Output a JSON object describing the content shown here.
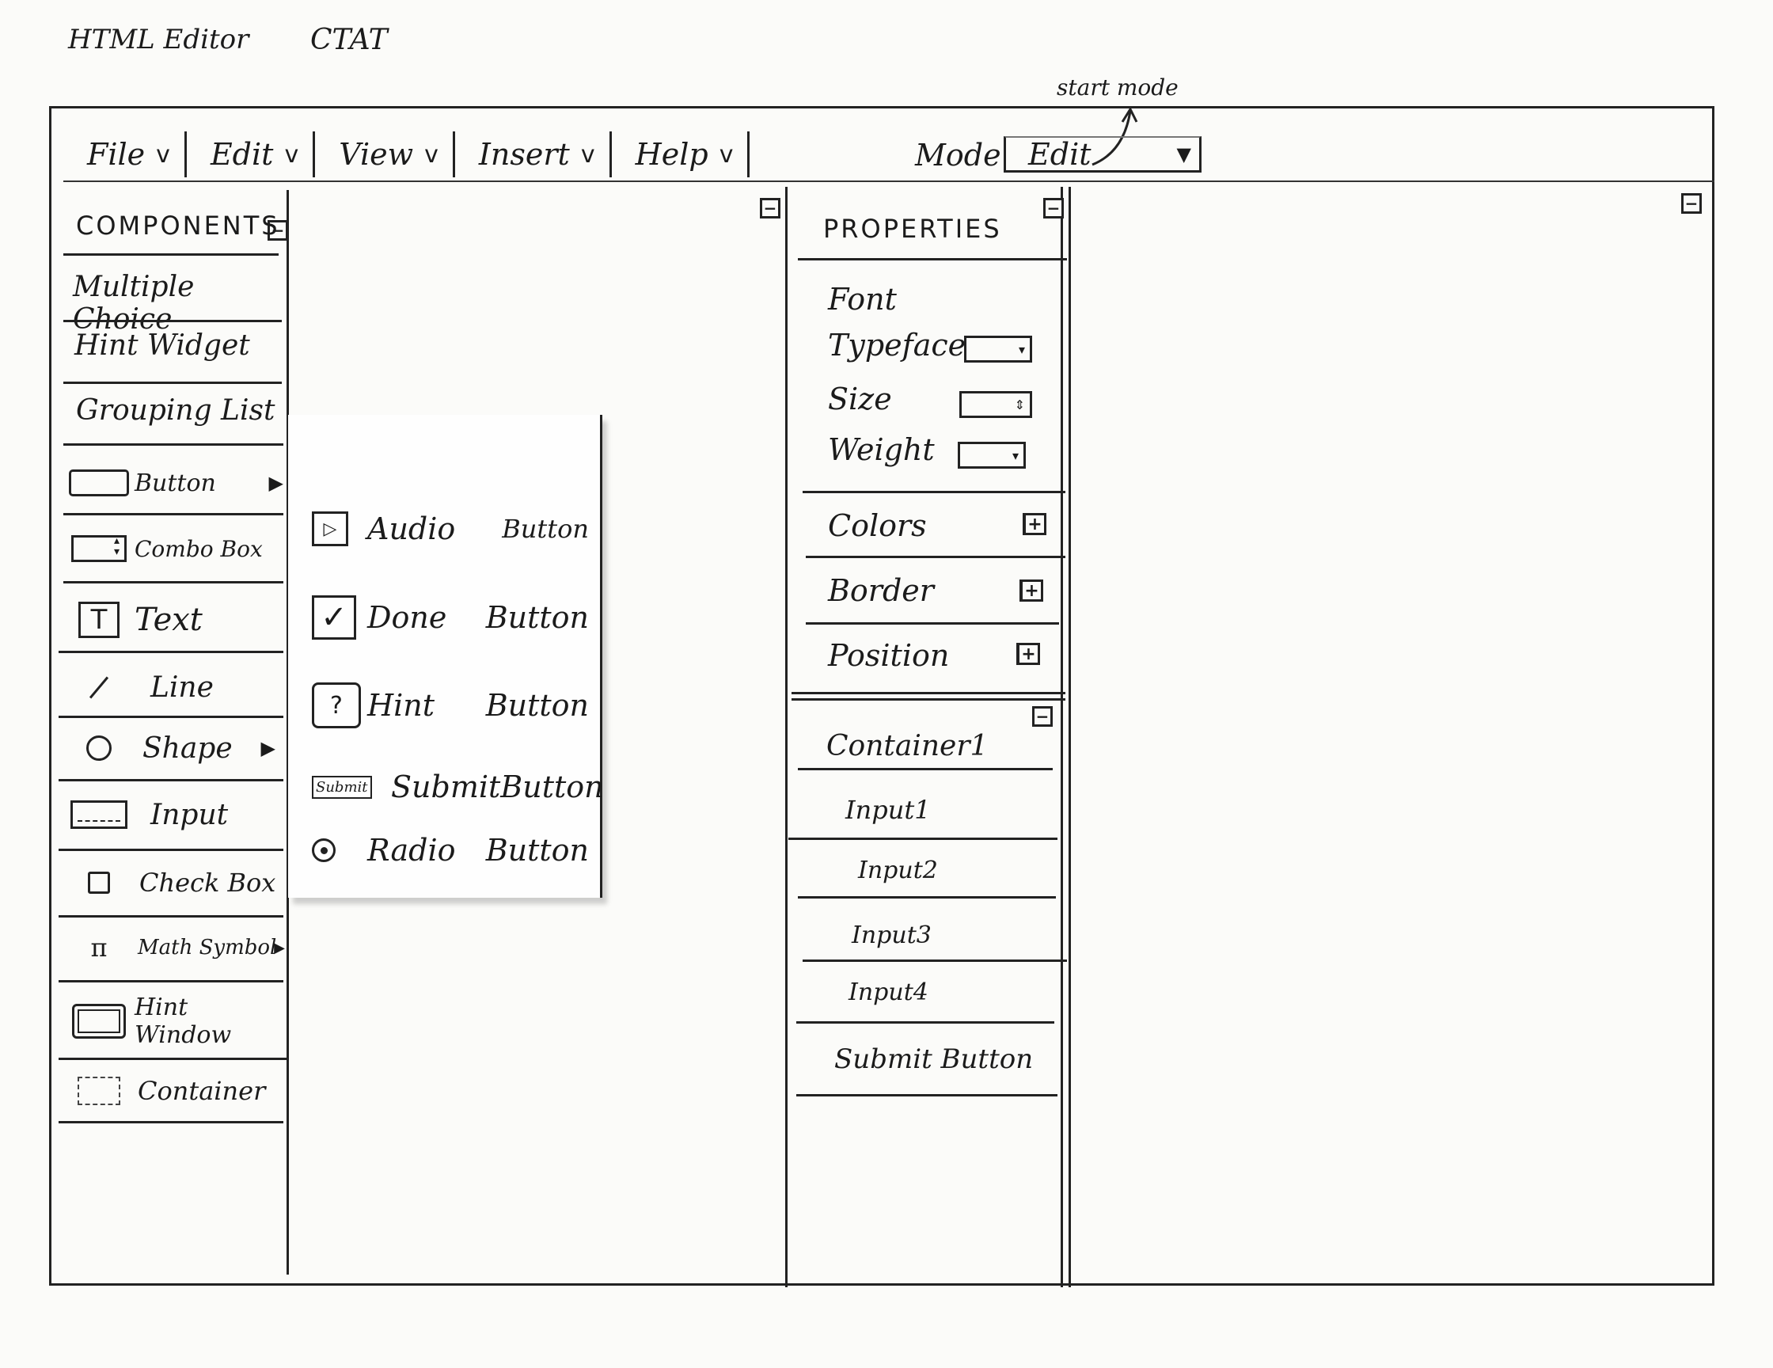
{
  "page": {
    "title_left": "HTML Editor",
    "title_right": "CTAT",
    "annotation": "start mode"
  },
  "menubar": {
    "items": [
      {
        "label": "File",
        "chevron": "v"
      },
      {
        "label": "Edit",
        "chevron": "v"
      },
      {
        "label": "View",
        "chevron": "v"
      },
      {
        "label": "Insert",
        "chevron": "v"
      },
      {
        "label": "Help",
        "chevron": "v"
      }
    ],
    "mode_label": "Mode",
    "mode_value": "Edit"
  },
  "components": {
    "header": "COMPONENTS",
    "items": [
      {
        "label": "Multiple Choice"
      },
      {
        "label": "Hint Widget"
      },
      {
        "label": "Grouping List"
      },
      {
        "label": "Button",
        "icon": "button-icon",
        "submenu": true
      },
      {
        "label": "Combo Box",
        "icon": "combo-box-icon"
      },
      {
        "label": "Text",
        "icon": "text-icon",
        "glyph": "T"
      },
      {
        "label": "Line",
        "icon": "line-icon"
      },
      {
        "label": "Shape",
        "icon": "circle-icon",
        "submenu": true
      },
      {
        "label": "Input",
        "icon": "input-icon"
      },
      {
        "label": "Check Box",
        "icon": "checkbox-icon"
      },
      {
        "label": "Math Symbol",
        "icon": "pi-icon",
        "glyph": "π",
        "submenu": true
      },
      {
        "label": "Hint Window",
        "icon": "window-icon"
      },
      {
        "label": "Container",
        "icon": "container-icon"
      }
    ]
  },
  "button_flyout": {
    "items": [
      {
        "word1": "Audio",
        "word2": "Button",
        "icon": "play-icon"
      },
      {
        "word1": "Done",
        "word2": "Button",
        "icon": "checkmark-icon"
      },
      {
        "word1": "Hint",
        "word2": "Button",
        "icon": "question-icon",
        "glyph": "?"
      },
      {
        "word1": "Submit",
        "word2": "Button",
        "icon": "submit-icon",
        "glyph": "Submit"
      },
      {
        "word1": "Radio",
        "word2": "Button",
        "icon": "radio-icon"
      }
    ]
  },
  "properties": {
    "header": "PROPERTIES",
    "font_label": "Font",
    "font_fields": [
      {
        "label": "Typeface"
      },
      {
        "label": "Size"
      },
      {
        "label": "Weight"
      }
    ],
    "sections": [
      {
        "label": "Colors",
        "toggle": "+"
      },
      {
        "label": "Border",
        "toggle": "+"
      },
      {
        "label": "Position",
        "toggle": "+"
      }
    ]
  },
  "tree": {
    "root": "Container1",
    "children": [
      "Input1",
      "Input2",
      "Input3",
      "Input4",
      "Submit Button"
    ]
  },
  "toggles": {
    "collapse": "−"
  }
}
